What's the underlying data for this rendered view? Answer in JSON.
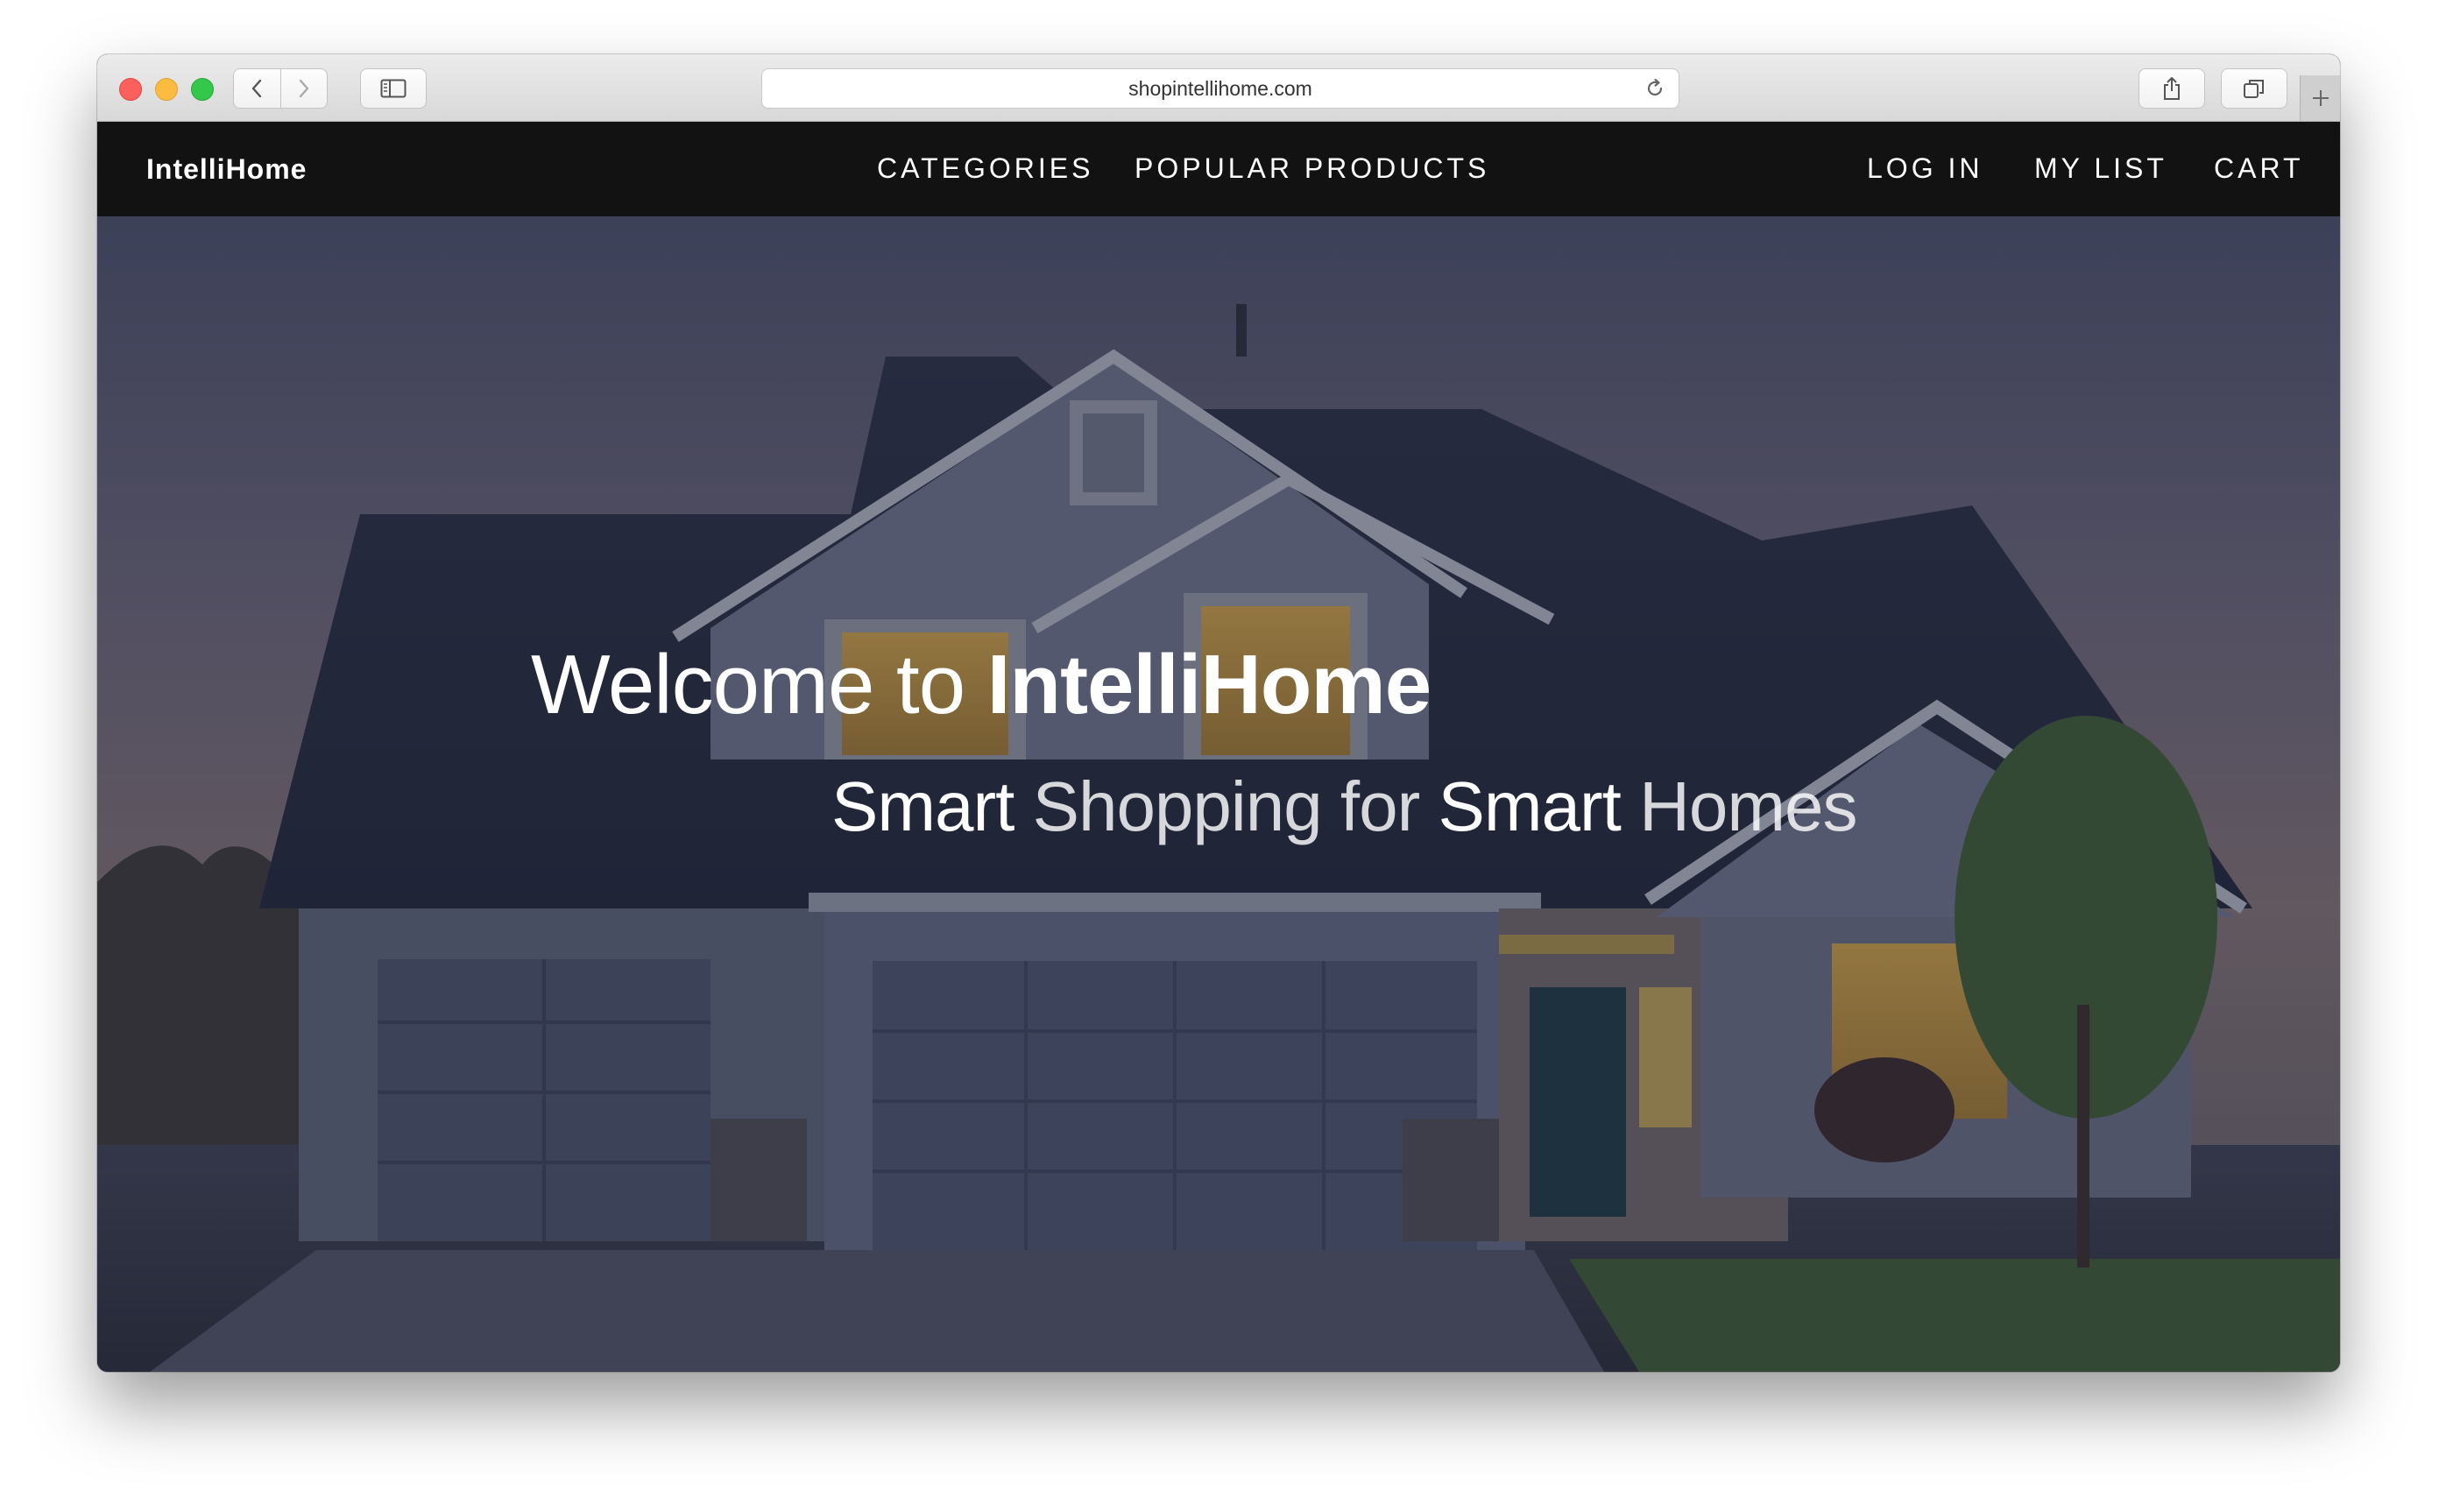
{
  "browser": {
    "url": "shopintellihome.com",
    "icons": {
      "back": "chevron-left-icon",
      "forward": "chevron-right-icon",
      "sidebar": "sidebar-icon",
      "reload": "reload-icon",
      "share": "share-icon",
      "tabs": "tabs-icon",
      "new_tab": "plus-icon"
    }
  },
  "site": {
    "brand": "IntelliHome",
    "nav_center": [
      "CATEGORIES",
      "POPULAR PRODUCTS"
    ],
    "nav_right": [
      "LOG IN",
      "MY LIST",
      "CART"
    ]
  },
  "hero": {
    "title_prefix": "Welcome to ",
    "title_brand": "IntelliHome",
    "subtitle": [
      {
        "text": "Smart",
        "style": "bold"
      },
      {
        "text": " Shopping for ",
        "style": "light"
      },
      {
        "text": "Smart",
        "style": "bold"
      },
      {
        "text": " Homes",
        "style": "light"
      }
    ],
    "background": "house-photo"
  },
  "colors": {
    "nav_bg": "#121212",
    "nav_text": "#ffffff",
    "traffic_red": "#fc605c",
    "traffic_yellow": "#fdbc40",
    "traffic_green": "#34c84a"
  }
}
